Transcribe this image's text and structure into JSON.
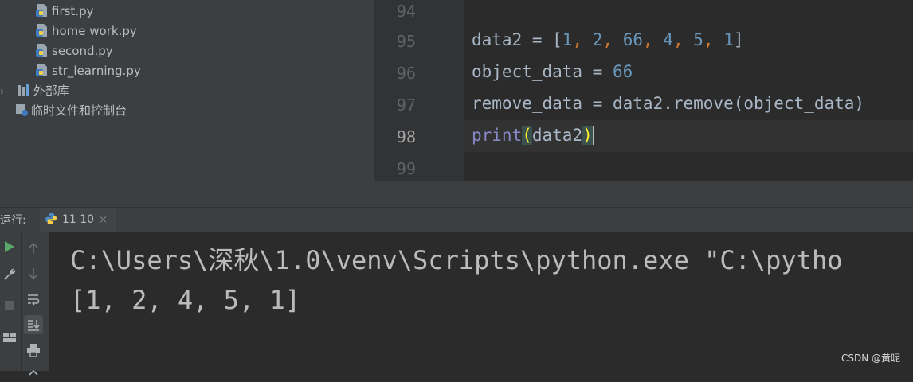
{
  "project_tree": {
    "files": [
      "first.py",
      "home work.py",
      "second.py",
      "str_learning.py"
    ],
    "external_libraries": "外部库",
    "scratches": "临时文件和控制台"
  },
  "editor": {
    "line_numbers": [
      "94",
      "95",
      "96",
      "97",
      "98",
      "99"
    ],
    "line95": {
      "lhs": "data2 = [",
      "v1": "1",
      "v2": "2",
      "v3": "66",
      "v4": "4",
      "v5": "5",
      "v6": "1",
      "close": "]"
    },
    "line96": {
      "lhs": "object_data = ",
      "value": "66"
    },
    "line97": {
      "text": "remove_data = data2.remove(object_data)"
    },
    "line98": {
      "fn": "print",
      "open": "(",
      "arg": "data2",
      "close": ")"
    }
  },
  "run_panel": {
    "label": "运行:",
    "tab_label": "11 10",
    "tab_close": "×"
  },
  "console": {
    "lines": [
      "C:\\Users\\深秋\\1.0\\venv\\Scripts\\python.exe \"C:\\pytho",
      "[1, 2, 4, 5, 1]"
    ]
  },
  "watermark": "CSDN @黄昵",
  "colors": {
    "number": "#6897bb",
    "comma": "#cc7832",
    "builtin": "#8888c6",
    "bracket_highlight": "#ffef28",
    "tab_underline": "#4a88c7"
  },
  "icons": [
    "python-file-icon",
    "library-icon",
    "scratches-icon",
    "run-icon",
    "wrench-icon",
    "stop-icon",
    "up-arrow-icon",
    "down-arrow-icon",
    "soft-wrap-icon",
    "scroll-to-end-icon",
    "print-icon",
    "layout-icon"
  ]
}
